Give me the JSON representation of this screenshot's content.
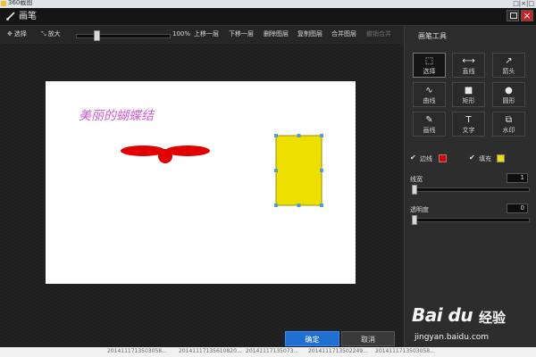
{
  "outer_window": {
    "title": "360截图",
    "controls": "□|×|□"
  },
  "window": {
    "title": "画笔"
  },
  "toolbar": {
    "select": "选择",
    "zoom_in": "放大",
    "zoom_value": "100%",
    "zoom_level": 0.2,
    "move_up": "上移一层",
    "move_down": "下移一层",
    "delete_layer": "删除图层",
    "copy_layer": "复制图层",
    "merge_layers": "合并图层",
    "undo_merge": "撤销合并"
  },
  "canvas": {
    "text": "美丽的蝴蝶结",
    "text_color": "#d15cd6"
  },
  "shapes": {
    "bow_color": "#e00000",
    "rect_fill": "#ede000",
    "handle_color": "#4f9fd6"
  },
  "buttons": {
    "ok": "确定",
    "cancel": "取消"
  },
  "panel": {
    "title": "画笔工具",
    "tools": [
      {
        "label": "选择",
        "icon": "select-icon",
        "glyph": "⬚",
        "active": true
      },
      {
        "label": "直线",
        "icon": "line-icon",
        "glyph": "⟷",
        "active": false
      },
      {
        "label": "箭头",
        "icon": "arrow-icon",
        "glyph": "↗",
        "active": false
      },
      {
        "label": "曲线",
        "icon": "curve-icon",
        "glyph": "∿",
        "active": false
      },
      {
        "label": "矩形",
        "icon": "rectangle-icon",
        "glyph": "■",
        "active": false
      },
      {
        "label": "圆形",
        "icon": "circle-icon",
        "glyph": "●",
        "active": false
      },
      {
        "label": "画线",
        "icon": "brush-icon",
        "glyph": "✎",
        "active": false
      },
      {
        "label": "文字",
        "icon": "text-icon",
        "glyph": "T",
        "active": false
      },
      {
        "label": "水印",
        "icon": "watermark-icon",
        "glyph": "⧉",
        "active": false
      }
    ],
    "border_label": "边线",
    "border_color": "#e00000",
    "fill_label": "填充",
    "fill_color": "#ede000",
    "line_width_label": "线宽",
    "line_width_value": "1",
    "opacity_label": "透明度",
    "opacity_value": "0"
  },
  "statusbar": {
    "items": [
      "2014111713503058...",
      "20141117135610820...",
      "20141117135073...",
      "2014111713502249...",
      "2014111713503058..."
    ]
  },
  "watermark": {
    "logo": "Bai du",
    "sub": "经验",
    "url": "jingyan.baidu.com"
  }
}
